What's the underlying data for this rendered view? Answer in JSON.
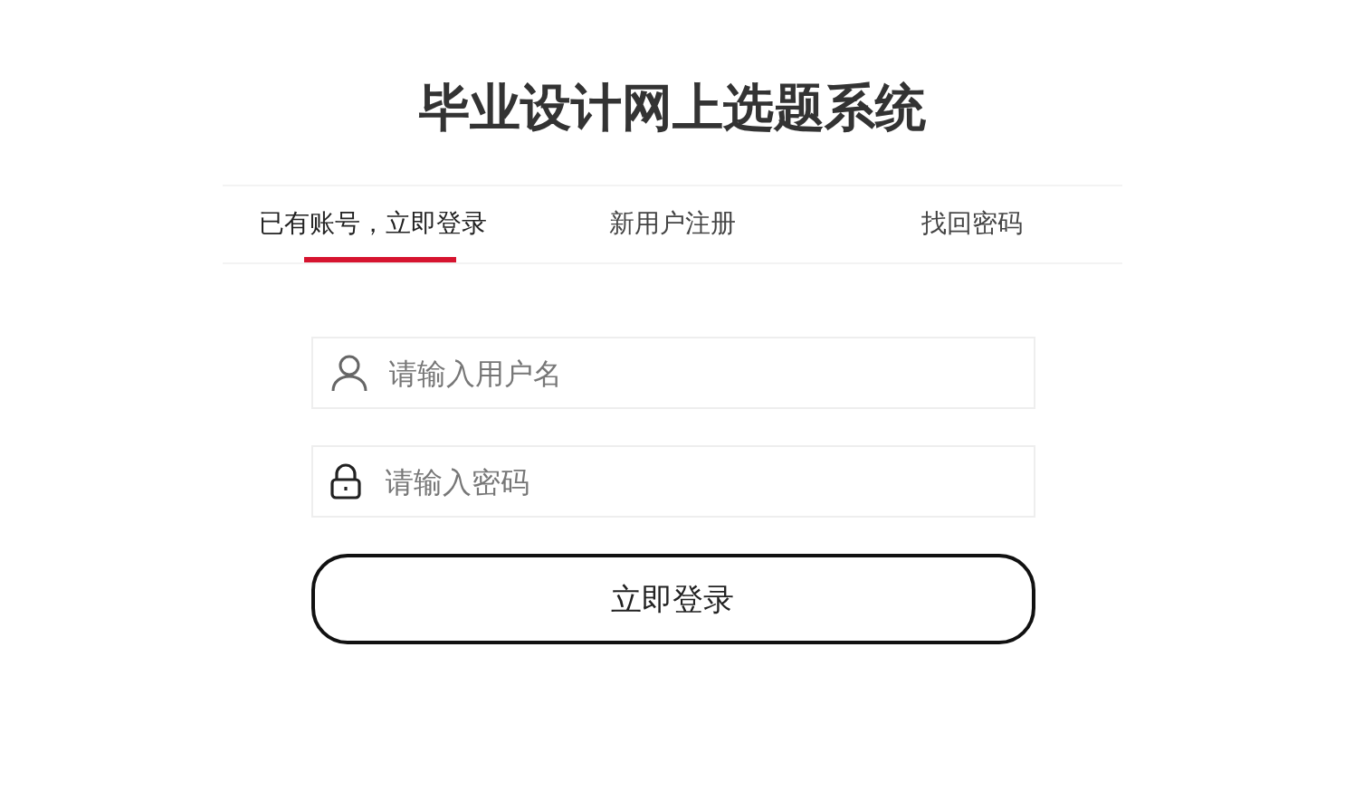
{
  "title": "毕业设计网上选题系统",
  "tabs": [
    {
      "label": "已有账号，立即登录",
      "selected": true
    },
    {
      "label": "新用户注册",
      "selected": false
    },
    {
      "label": "找回密码",
      "selected": false
    }
  ],
  "fields": [
    {
      "kind": "user",
      "placeholder": "请输入用户名"
    },
    {
      "kind": "password",
      "placeholder": "请输入密码"
    }
  ],
  "submit": "立即登录"
}
